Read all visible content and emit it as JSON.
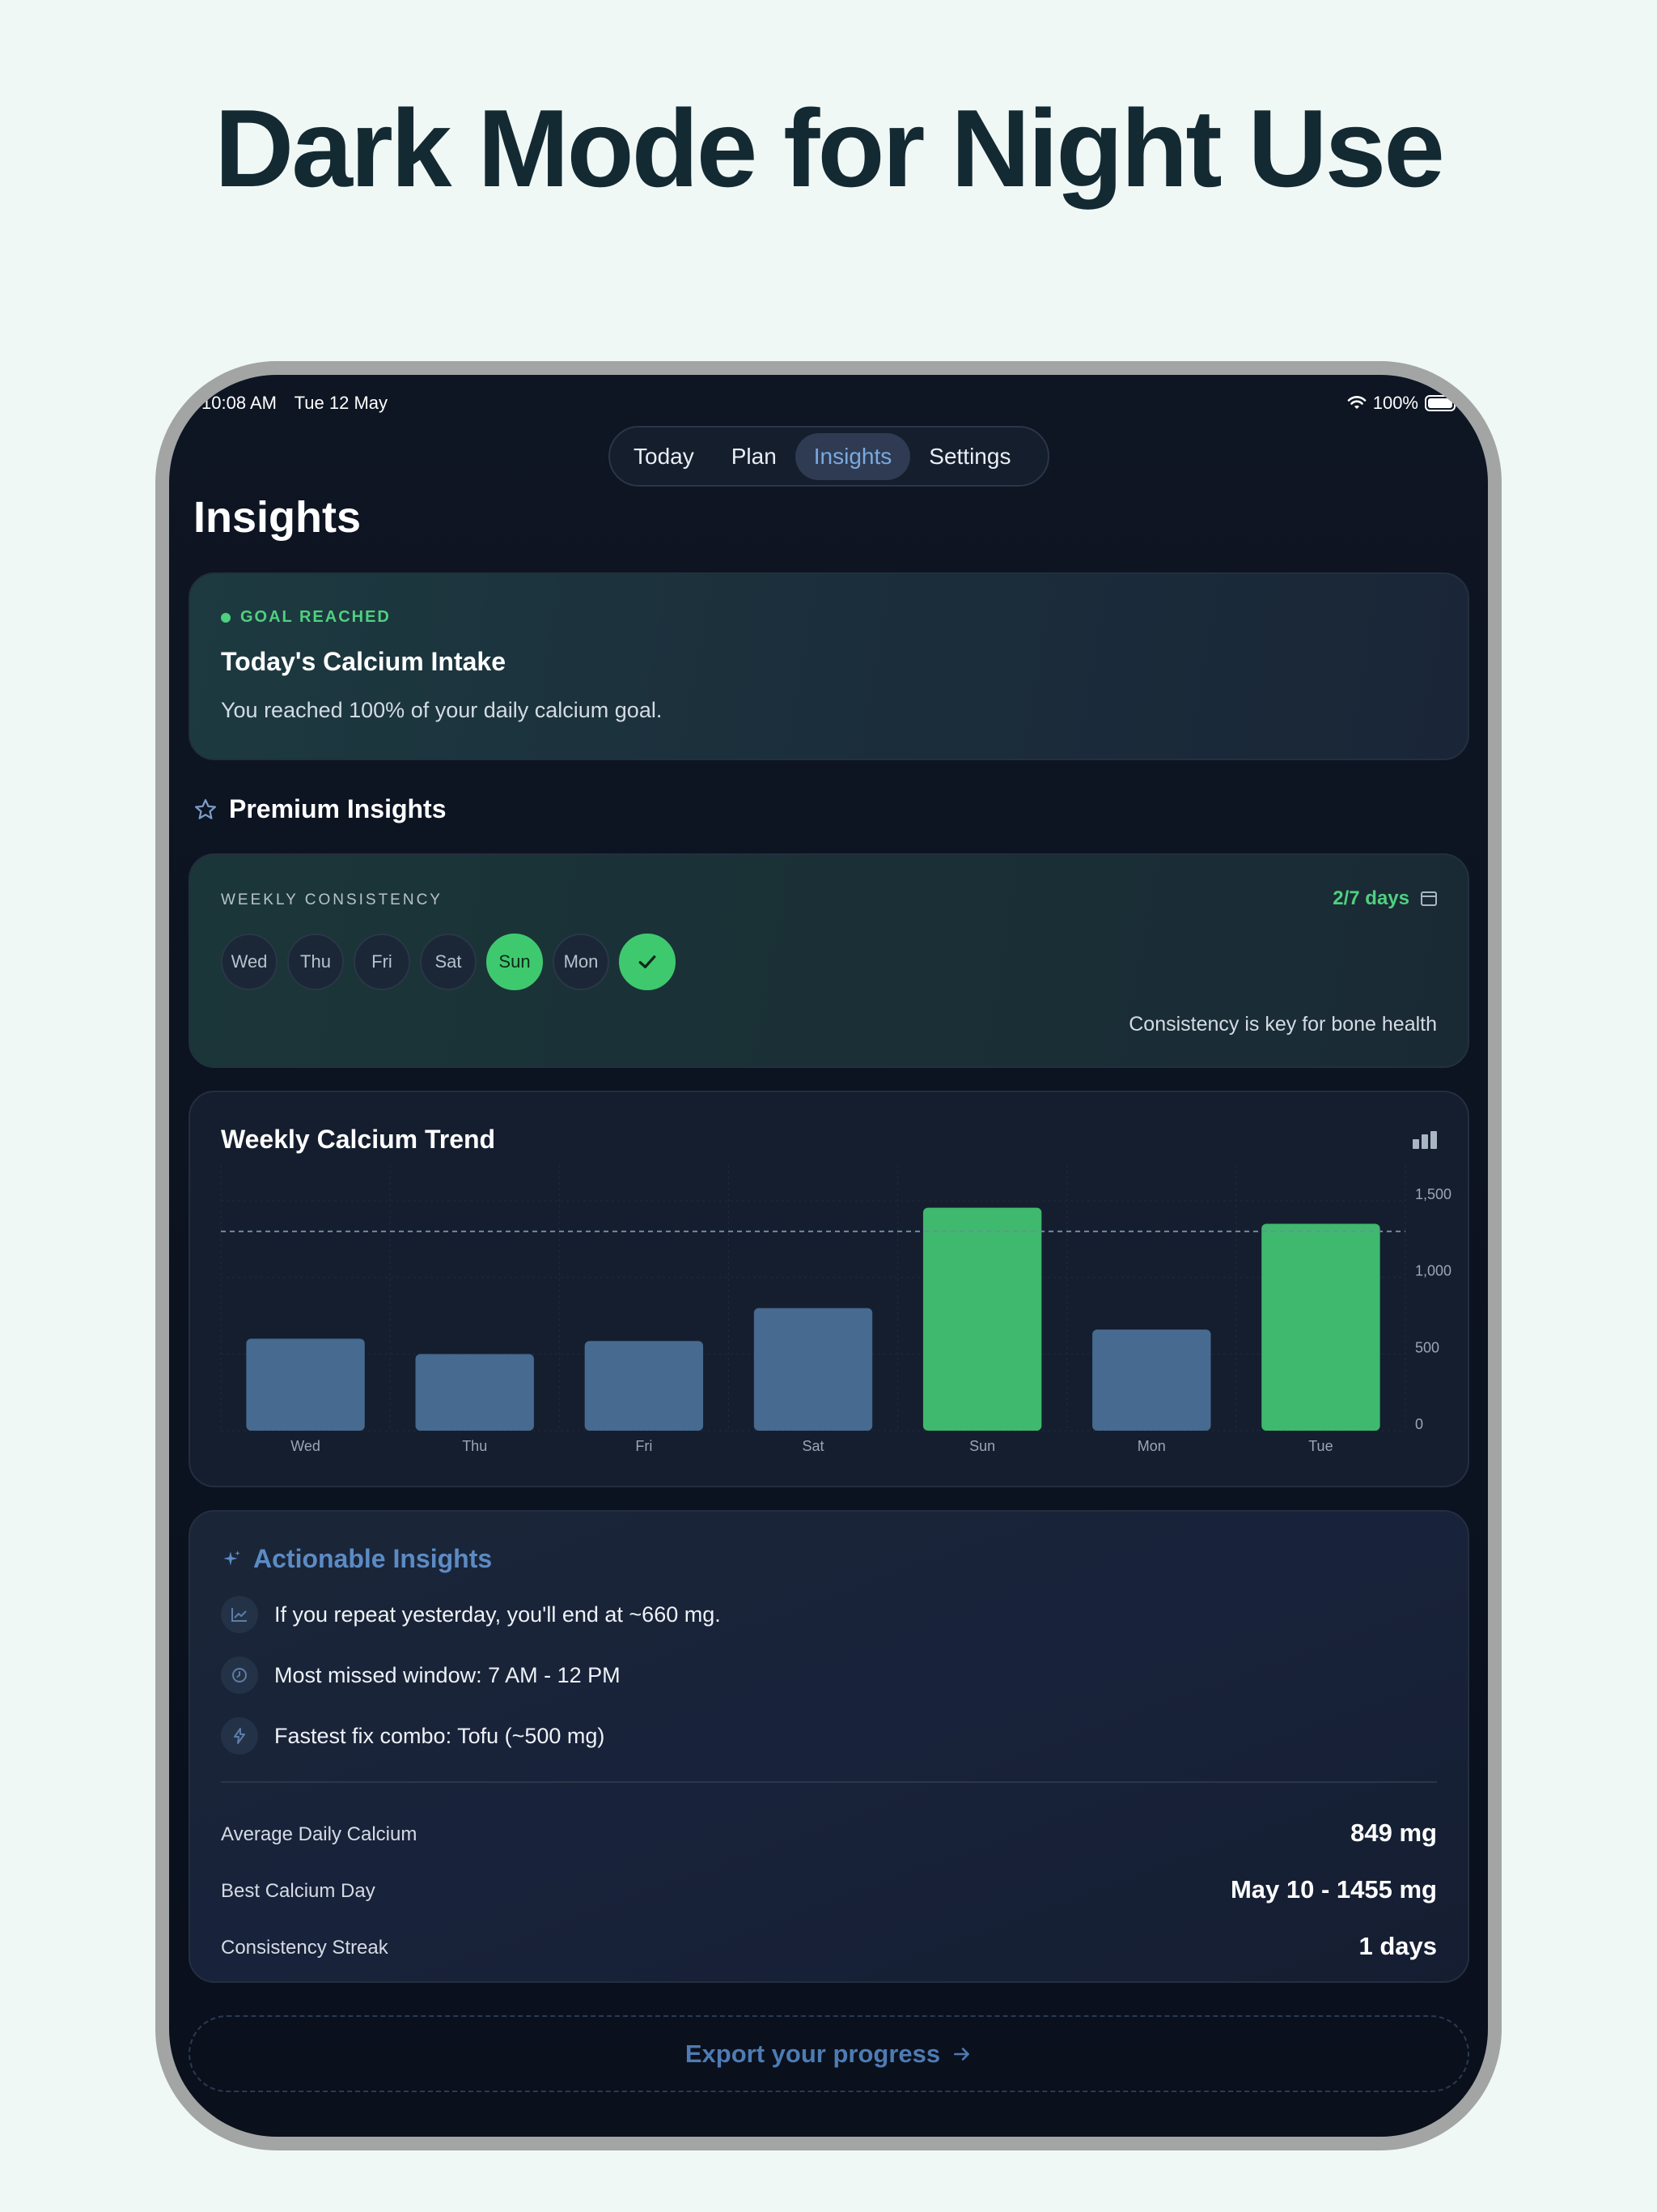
{
  "headline": "Dark Mode for Night Use",
  "status_bar": {
    "time": "10:08 AM",
    "date": "Tue 12 May",
    "battery": "100%"
  },
  "tabs": [
    {
      "label": "Today",
      "active": false
    },
    {
      "label": "Plan",
      "active": false
    },
    {
      "label": "Insights",
      "active": true
    },
    {
      "label": "Settings",
      "active": false
    }
  ],
  "page_title": "Insights",
  "goal_card": {
    "badge": "GOAL REACHED",
    "title": "Today's Calcium Intake",
    "text": "You reached 100% of your daily calcium goal."
  },
  "premium": {
    "title": "Premium Insights"
  },
  "weekly_consistency": {
    "label": "WEEKLY CONSISTENCY",
    "days_count": "2/7 days",
    "days": [
      {
        "label": "Wed",
        "met": false
      },
      {
        "label": "Thu",
        "met": false
      },
      {
        "label": "Fri",
        "met": false
      },
      {
        "label": "Sat",
        "met": false
      },
      {
        "label": "Sun",
        "met": true
      },
      {
        "label": "Mon",
        "met": false
      },
      {
        "label": "",
        "met": true,
        "today": true
      }
    ],
    "note": "Consistency is key for bone health"
  },
  "trend": {
    "title": "Weekly Calcium Trend"
  },
  "chart_data": {
    "type": "bar",
    "title": "Weekly Calcium Trend",
    "categories": [
      "Wed",
      "Thu",
      "Fri",
      "Sat",
      "Sun",
      "Mon",
      "Tue"
    ],
    "values": [
      600,
      500,
      585,
      800,
      1455,
      660,
      1350
    ],
    "goal_line": 1300,
    "y_ticks": [
      "1,500",
      "1,000",
      "500",
      "0"
    ],
    "y_tick_values": [
      1500,
      1000,
      500,
      0
    ],
    "ylim": [
      0,
      1680
    ],
    "colors": {
      "met": "#3fb96d",
      "unmet": "#466a90",
      "grid": "#1f2a3b",
      "goal": "#6f8aa5",
      "label": "#9aa6b4"
    },
    "met": [
      false,
      false,
      false,
      false,
      true,
      false,
      true
    ]
  },
  "actionable": {
    "title": "Actionable Insights",
    "items": [
      {
        "icon": "trend-up-icon",
        "text": "If you repeat yesterday, you'll end at ~660 mg."
      },
      {
        "icon": "clock-icon",
        "text": "Most missed window: 7 AM - 12 PM"
      },
      {
        "icon": "bolt-icon",
        "text": "Fastest fix combo: Tofu (~500 mg)"
      }
    ],
    "stats": [
      {
        "label": "Average Daily Calcium",
        "value": "849 mg"
      },
      {
        "label": "Best Calcium Day",
        "value": "May 10 - 1455 mg"
      },
      {
        "label": "Consistency Streak",
        "value": "1 days"
      }
    ]
  },
  "export": {
    "label": "Export your progress"
  }
}
